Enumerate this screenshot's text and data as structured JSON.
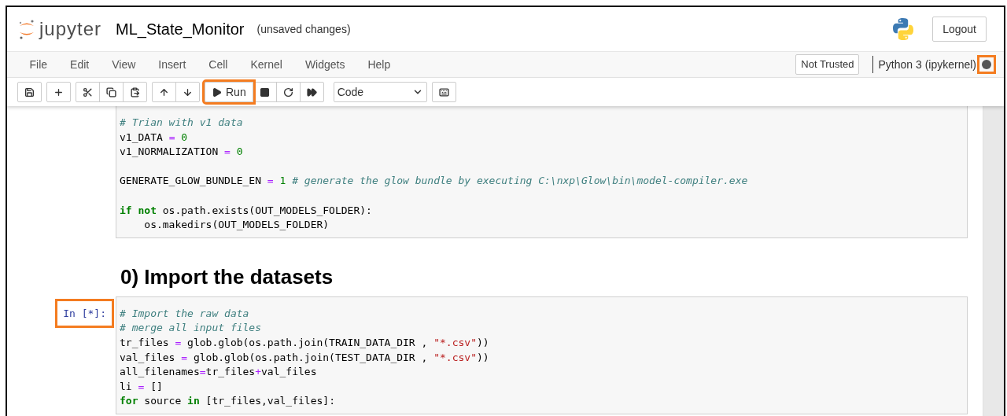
{
  "header": {
    "logo_text": "jupyter",
    "title": "ML_State_Monitor",
    "save_status": "(unsaved changes)",
    "logout": "Logout"
  },
  "menu": {
    "items": [
      "File",
      "Edit",
      "View",
      "Insert",
      "Cell",
      "Kernel",
      "Widgets",
      "Help"
    ],
    "trusted": "Not Trusted",
    "kernel": {
      "name": "Python 3 (ipykernel)",
      "busy": true,
      "highlighted": true
    }
  },
  "toolbar": {
    "groups": [
      [
        {
          "kind": "save"
        }
      ],
      [
        {
          "kind": "add"
        }
      ],
      [
        {
          "kind": "cut"
        },
        {
          "kind": "copy"
        },
        {
          "kind": "paste"
        }
      ],
      [
        {
          "kind": "up"
        },
        {
          "kind": "down"
        }
      ],
      [
        {
          "kind": "run",
          "label": "Run",
          "highlighted": true
        },
        {
          "kind": "stop"
        },
        {
          "kind": "restart"
        },
        {
          "kind": "run-all"
        }
      ],
      [
        {
          "kind": "select",
          "label": "Code"
        }
      ],
      [
        {
          "kind": "keyboard"
        }
      ]
    ]
  },
  "cells": [
    {
      "kind": "code",
      "lines": [
        {
          "kind": "code",
          "tokens": [
            {
              "kind": "comment",
              "text": "# Trian with v1 data"
            }
          ]
        },
        {
          "kind": "code",
          "tokens": [
            {
              "kind": "plain",
              "text": "v1_DATA "
            },
            {
              "kind": "op",
              "text": "="
            },
            {
              "kind": "number",
              "text": " 0"
            }
          ]
        },
        {
          "kind": "code",
          "tokens": [
            {
              "kind": "plain",
              "text": "v1_NORMALIZATION "
            },
            {
              "kind": "op",
              "text": "="
            },
            {
              "kind": "number",
              "text": " 0"
            }
          ]
        },
        {
          "kind": "blank"
        },
        {
          "kind": "code",
          "tokens": [
            {
              "kind": "plain",
              "text": "GENERATE_GLOW_BUNDLE_EN "
            },
            {
              "kind": "op",
              "text": "="
            },
            {
              "kind": "number",
              "text": " 1"
            },
            {
              "kind": "comment",
              "text": " # generate the glow bundle by executing C:\\nxp\\Glow\\bin\\model-compiler.exe"
            }
          ]
        },
        {
          "kind": "blank"
        },
        {
          "kind": "code",
          "tokens": [
            {
              "kind": "keyword",
              "text": "if not"
            },
            {
              "kind": "plain",
              "text": " os.path.exists(OUT_MODELS_FOLDER):"
            }
          ]
        },
        {
          "kind": "code",
          "tokens": [
            {
              "kind": "plain",
              "text": "    os.makedirs(OUT_MODELS_FOLDER)"
            }
          ]
        }
      ]
    },
    {
      "kind": "heading",
      "text": "0) Import the datasets"
    },
    {
      "kind": "code",
      "prompt": "In [*]:",
      "prompt_highlighted": true,
      "lines": [
        {
          "kind": "code",
          "tokens": [
            {
              "kind": "comment",
              "text": "# Import the raw data"
            }
          ]
        },
        {
          "kind": "code",
          "tokens": [
            {
              "kind": "comment",
              "text": "# merge all input files"
            }
          ]
        },
        {
          "kind": "code",
          "tokens": [
            {
              "kind": "plain",
              "text": "tr_files "
            },
            {
              "kind": "op",
              "text": "="
            },
            {
              "kind": "plain",
              "text": " glob.glob(os.path.join(TRAIN_DATA_DIR , "
            },
            {
              "kind": "string",
              "text": "\"*.csv\""
            },
            {
              "kind": "plain",
              "text": "))"
            }
          ]
        },
        {
          "kind": "code",
          "tokens": [
            {
              "kind": "plain",
              "text": "val_files "
            },
            {
              "kind": "op",
              "text": "="
            },
            {
              "kind": "plain",
              "text": " glob.glob(os.path.join(TEST_DATA_DIR , "
            },
            {
              "kind": "string",
              "text": "\"*.csv\""
            },
            {
              "kind": "plain",
              "text": "))"
            }
          ]
        },
        {
          "kind": "code",
          "tokens": [
            {
              "kind": "plain",
              "text": "all_filenames"
            },
            {
              "kind": "op",
              "text": "="
            },
            {
              "kind": "plain",
              "text": "tr_files"
            },
            {
              "kind": "op",
              "text": "+"
            },
            {
              "kind": "plain",
              "text": "val_files"
            }
          ]
        },
        {
          "kind": "code",
          "tokens": [
            {
              "kind": "plain",
              "text": "li "
            },
            {
              "kind": "op",
              "text": "="
            },
            {
              "kind": "plain",
              "text": " []"
            }
          ]
        },
        {
          "kind": "code",
          "tokens": [
            {
              "kind": "keyword",
              "text": "for"
            },
            {
              "kind": "plain",
              "text": " source "
            },
            {
              "kind": "keyword",
              "text": "in"
            },
            {
              "kind": "plain",
              "text": " [tr_files,val_files]:"
            }
          ]
        }
      ]
    }
  ]
}
